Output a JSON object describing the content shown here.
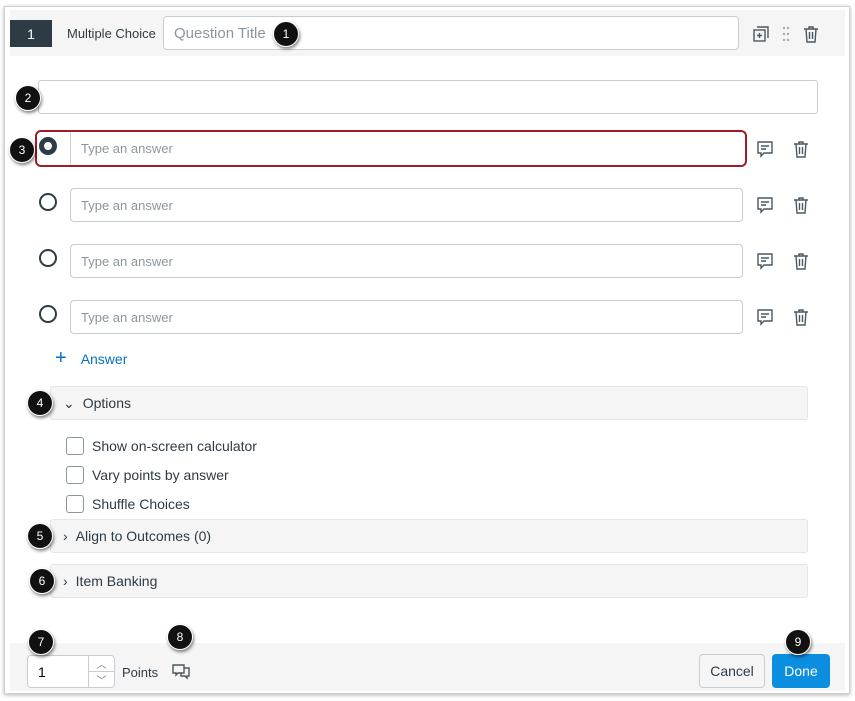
{
  "header": {
    "question_number": "1",
    "question_type": "Multiple Choice",
    "title_placeholder": "Question Title"
  },
  "answers": [
    {
      "placeholder": "Type an answer",
      "selected": true
    },
    {
      "placeholder": "Type an answer",
      "selected": false
    },
    {
      "placeholder": "Type an answer",
      "selected": false
    },
    {
      "placeholder": "Type an answer",
      "selected": false
    }
  ],
  "add_answer_label": "Answer",
  "options": {
    "label": "Options",
    "checkboxes": [
      "Show on-screen calculator",
      "Vary points by answer",
      "Shuffle Choices"
    ]
  },
  "align_outcomes_label": "Align to Outcomes (0)",
  "item_banking_label": "Item Banking",
  "footer": {
    "points_value": "1",
    "points_label": "Points",
    "cancel_label": "Cancel",
    "done_label": "Done"
  },
  "callouts": [
    "1",
    "2",
    "3",
    "4",
    "5",
    "6",
    "7",
    "8",
    "9"
  ],
  "colors": {
    "accent": "#0b8ee0",
    "selected_border": "#a01c24",
    "header_dark": "#2d3b45"
  }
}
